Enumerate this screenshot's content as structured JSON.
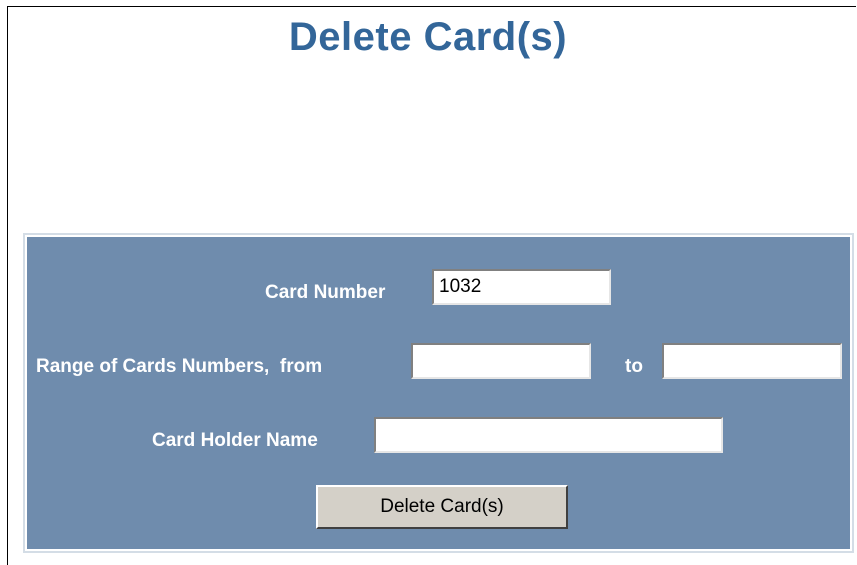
{
  "page": {
    "title": "Delete Card(s)"
  },
  "form": {
    "card_number": {
      "label": "Card Number",
      "value": "1032"
    },
    "range": {
      "label_from": "Range of Cards Numbers,  from",
      "label_to": "to",
      "from_value": "",
      "to_value": ""
    },
    "card_holder": {
      "label": "Card Holder Name",
      "value": ""
    },
    "submit_label": "Delete Card(s)"
  },
  "colors": {
    "title": "#336699",
    "panel_bg": "#6f8cad",
    "button_bg": "#d4d0c8",
    "label_text": "#ffffff"
  }
}
